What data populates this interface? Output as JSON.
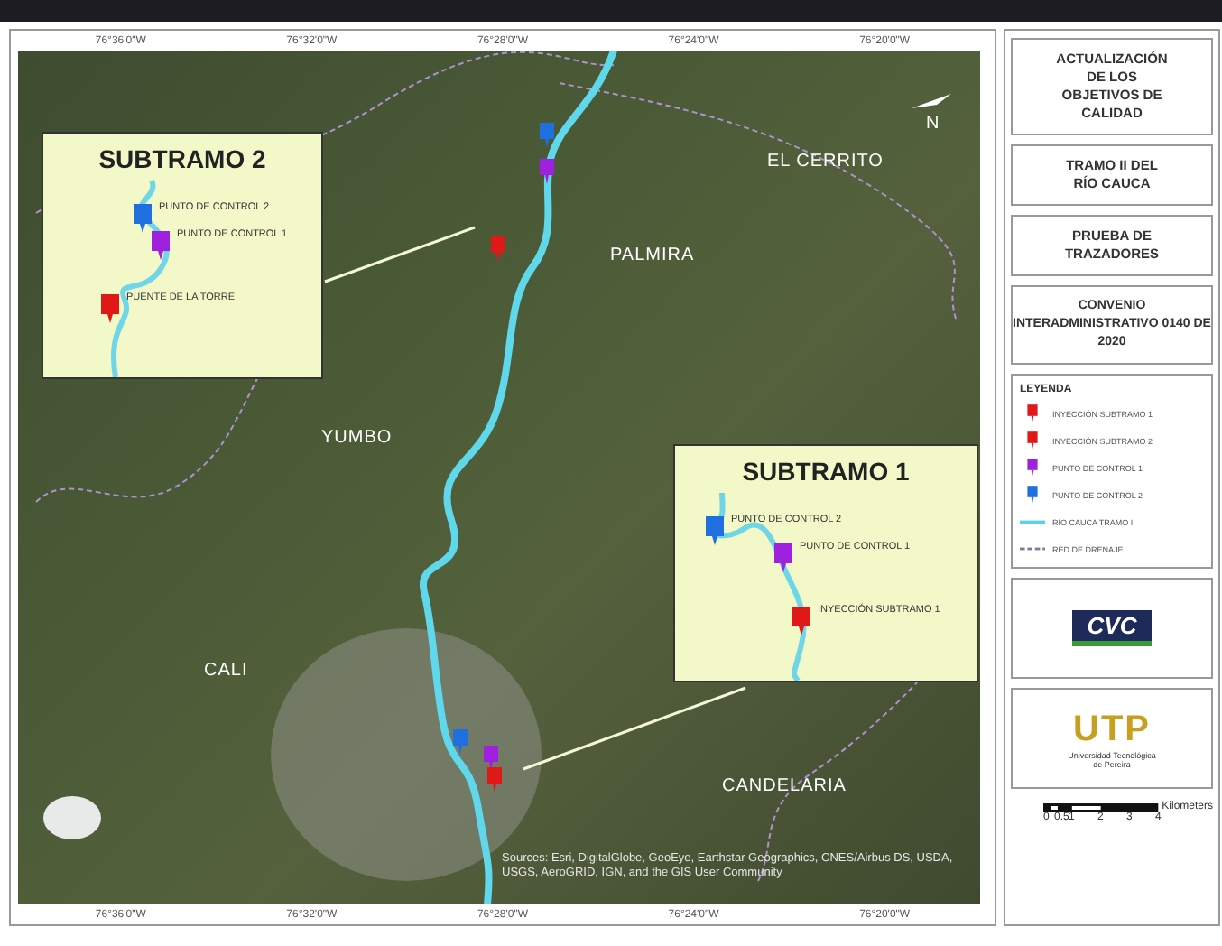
{
  "map": {
    "top_ticks": [
      "76°36'0\"W",
      "76°32'0\"W",
      "76°28'0\"W",
      "76°24'0\"W",
      "76°20'0\"W"
    ],
    "bottom_ticks": [
      "76°36'0\"W",
      "76°32'0\"W",
      "76°28'0\"W",
      "76°24'0\"W",
      "76°20'0\"W"
    ],
    "places": [
      "EL CERRITO",
      "PALMIRA",
      "YUMBO",
      "CALI",
      "CANDELARIA"
    ],
    "north_label": "N",
    "markers": [
      {
        "color": "#1f6fe0"
      },
      {
        "color": "#a020e0"
      },
      {
        "color": "#e01818"
      },
      {
        "color": "#1f6fe0"
      },
      {
        "color": "#a020e0"
      },
      {
        "color": "#e01818"
      }
    ],
    "insets": [
      {
        "title": "SUBTRAMO 2",
        "markers": [
          {
            "label": "PUNTO DE CONTROL 2",
            "color": "#1f6fe0"
          },
          {
            "label": "PUNTO DE CONTROL 1",
            "color": "#a020e0"
          },
          {
            "label": "PUENTE DE LA TORRE",
            "color": "#e01818"
          }
        ]
      },
      {
        "title": "SUBTRAMO 1",
        "markers": [
          {
            "label": "PUNTO DE CONTROL 2",
            "color": "#1f6fe0"
          },
          {
            "label": "PUNTO DE CONTROL 1",
            "color": "#a020e0"
          },
          {
            "label": "INYECCIÓN SUBTRAMO 1",
            "color": "#e01818"
          }
        ]
      }
    ],
    "attribution": "Sources: Esri, DigitalGlobe, GeoEye, Earthstar Geographics, CNES/Airbus DS, USDA, USGS, AeroGRID, IGN, and the GIS User Community"
  },
  "titles": [
    "ACTUALIZACIÓN DE LOS OBJETIVOS DE CALIDAD",
    "TRAMO II DEL RÍO CAUCA",
    "PRUEBA DE TRAZADORES",
    "CONVENIO INTERADMINISTRATIVO 0140 DE 2020"
  ],
  "legend": {
    "title": "LEYENDA",
    "items": [
      {
        "kind": "pin",
        "label": "INYECCIÓN SUBTRAMO 1",
        "color": "#e01818"
      },
      {
        "kind": "pin",
        "label": "INYECCIÓN SUBTRAMO 2",
        "color": "#e01818"
      },
      {
        "kind": "pin",
        "label": "PUNTO DE CONTROL 1",
        "color": "#a020e0"
      },
      {
        "kind": "pin",
        "label": "PUNTO DE CONTROL 2",
        "color": "#1f6fe0"
      },
      {
        "kind": "line",
        "label": "RÍO CAUCA TRAMO II",
        "color": "#5fd0e8"
      },
      {
        "kind": "dash",
        "label": "RED DE DRENAJE",
        "color": "#7a7a9a"
      }
    ]
  },
  "logos": [
    {
      "kind": "cvc",
      "text": "CVC"
    },
    {
      "kind": "utp",
      "text": "UTP",
      "caption": "Universidad Tecnológica de Pereira"
    }
  ],
  "scale": {
    "labels": [
      "0",
      "0.5",
      "1",
      "2",
      "3",
      "4"
    ],
    "unit": "Kilometers"
  }
}
